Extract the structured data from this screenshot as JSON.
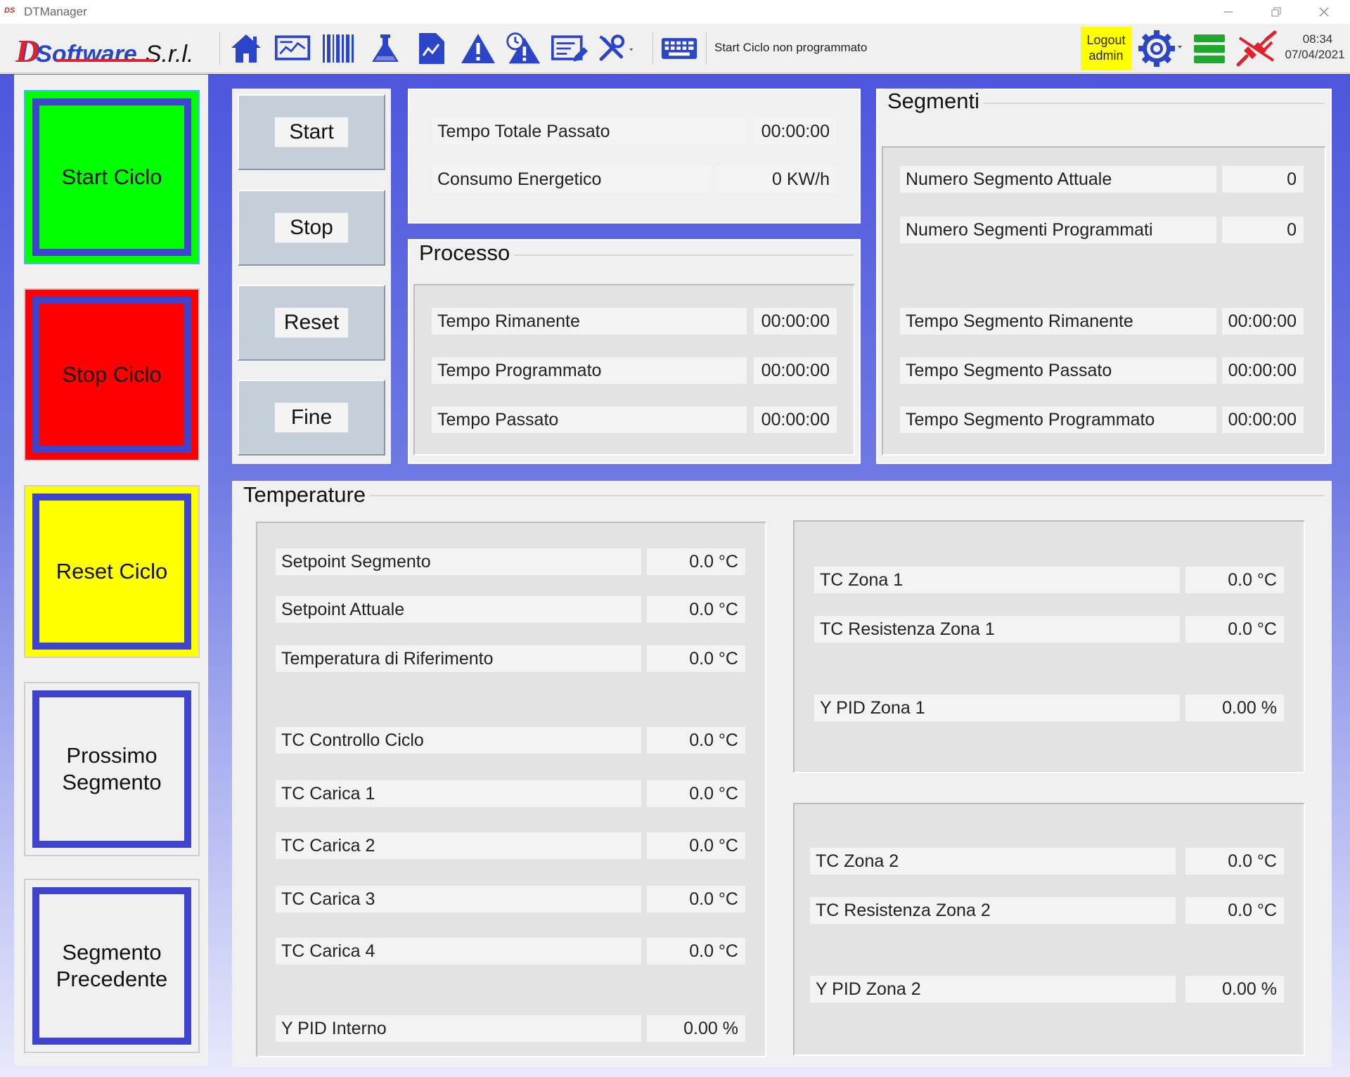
{
  "window": {
    "title": "DTManager",
    "logo_text": "DS"
  },
  "toolbar": {
    "brand_letters": "D",
    "brand_software": "Software",
    "brand_srl": "S.r.l.",
    "status_message": "Start Ciclo non programmato",
    "logout_line1": "Logout",
    "logout_line2": "admin",
    "time": "08:34",
    "date": "07/04/2021",
    "icons": [
      "home-icon",
      "monitor-icon",
      "barcode-icon",
      "flask-icon",
      "document-chart-icon",
      "warning-icon",
      "alarm-warning-icon",
      "edit-form-icon",
      "tools-icon",
      "keyboard-icon",
      "settings-gear-icon",
      "menu-lines-icon",
      "disconnected-plug-icon"
    ],
    "colors": {
      "accent": "#2b45c8",
      "brand_red": "#e0202a",
      "logout_bg": "#ffff00",
      "plug_red": "#e0202a",
      "menu_green": "#1ea82d"
    }
  },
  "cycle_buttons": {
    "start": "Start Ciclo",
    "stop": "Stop Ciclo",
    "reset": "Reset Ciclo",
    "next_line1": "Prossimo",
    "next_line2": "Segmento",
    "prev_line1": "Segmento",
    "prev_line2": "Precedente",
    "colors": {
      "start": "#00ff00",
      "stop": "#ff0000",
      "reset": "#ffff00",
      "neutral": "#f0f0f0",
      "border": "#3f44cf"
    }
  },
  "controls": {
    "start": "Start",
    "stop": "Stop",
    "reset": "Reset",
    "fine": "Fine"
  },
  "totals": {
    "tempo_totale_label": "Tempo Totale Passato",
    "tempo_totale_value": "00:00:00",
    "consumo_label": "Consumo Energetico",
    "consumo_value": "0 KW/h"
  },
  "processo": {
    "title": "Processo",
    "rows": [
      {
        "label": "Tempo Rimanente",
        "value": "00:00:00"
      },
      {
        "label": "Tempo Programmato",
        "value": "00:00:00"
      },
      {
        "label": "Tempo Passato",
        "value": "00:00:00"
      }
    ]
  },
  "segmenti": {
    "title": "Segmenti",
    "rows": [
      {
        "label": "Numero Segmento Attuale",
        "value": "0"
      },
      {
        "label": "Numero Segmenti Programmati",
        "value": "0"
      },
      {
        "label": "Tempo Segmento Rimanente",
        "value": "00:00:00"
      },
      {
        "label": "Tempo Segmento Passato",
        "value": "00:00:00"
      },
      {
        "label": "Tempo Segmento Programmato",
        "value": "00:00:00"
      }
    ]
  },
  "temperature": {
    "title": "Temperature",
    "left": [
      {
        "label": "Setpoint Segmento",
        "value": "0.0 °C"
      },
      {
        "label": "Setpoint Attuale",
        "value": "0.0 °C"
      },
      {
        "label": "Temperatura di Riferimento",
        "value": "0.0 °C"
      },
      {
        "label": "TC Controllo Ciclo",
        "value": "0.0 °C"
      },
      {
        "label": "TC Carica 1",
        "value": "0.0 °C"
      },
      {
        "label": "TC Carica 2",
        "value": "0.0 °C"
      },
      {
        "label": "TC Carica 3",
        "value": "0.0 °C"
      },
      {
        "label": "TC Carica 4",
        "value": "0.0 °C"
      },
      {
        "label": "Y PID Interno",
        "value": "0.00 %"
      }
    ],
    "zona1": [
      {
        "label": "TC Zona 1",
        "value": "0.0 °C"
      },
      {
        "label": "TC Resistenza Zona 1",
        "value": "0.0 °C"
      },
      {
        "label": "Y PID Zona 1",
        "value": "0.00 %"
      }
    ],
    "zona2": [
      {
        "label": "TC Zona 2",
        "value": "0.0 °C"
      },
      {
        "label": "TC Resistenza Zona 2",
        "value": "0.0 °C"
      },
      {
        "label": "Y PID Zona 2",
        "value": "0.00 %"
      }
    ]
  }
}
